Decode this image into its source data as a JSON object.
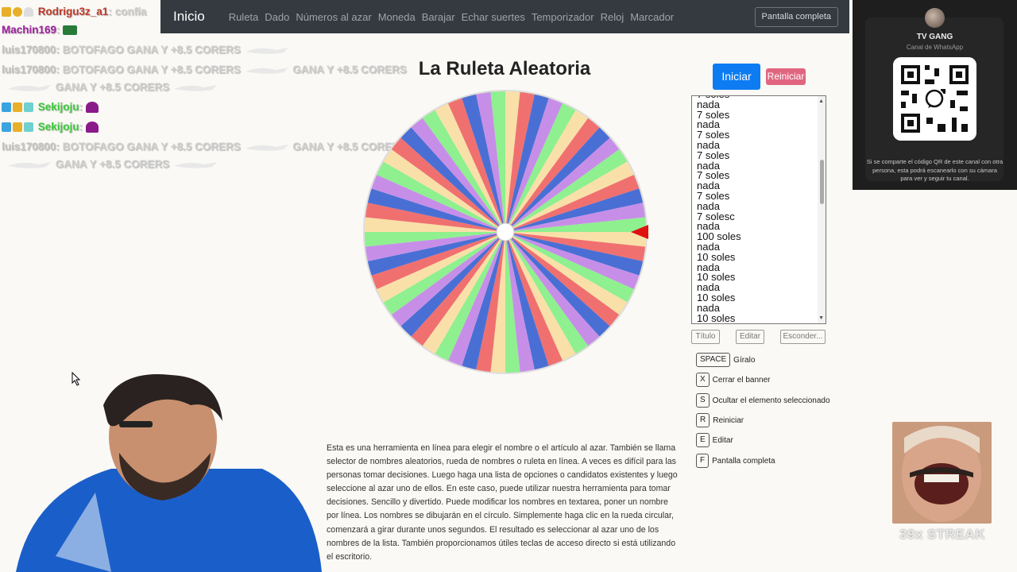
{
  "navbar": {
    "brand": "Inicio",
    "links": [
      "Ruleta",
      "Dado",
      "Números al azar",
      "Moneda",
      "Barajar",
      "Echar suertes",
      "Temporizador",
      "Reloj",
      "Marcador"
    ],
    "fullscreen_label": "Pantalla completa"
  },
  "chat": {
    "lines": [
      {
        "user": "Rodrigu3z_a1",
        "sep": ":",
        "msg": "confía"
      },
      {
        "user": "Machin169",
        "sep": ":",
        "msg": ""
      },
      {
        "user": "luis170800",
        "sep": ":",
        "msg": "BOTOFAGO GANA Y +8.5 CORERS"
      },
      {
        "user": "luis170800",
        "sep": ":",
        "msg": "BOTOFAGO GANA Y +8.5 CORERS"
      },
      {
        "user": "",
        "sep": "",
        "msg": "GANA Y +8.5 CORERS"
      },
      {
        "user": "Sekijoju",
        "sep": ":",
        "msg": ""
      },
      {
        "user": "Sekijoju",
        "sep": ":",
        "msg": ""
      },
      {
        "user": "luis170800",
        "sep": ":",
        "msg": "BOTOFAGO GANA Y +8.5 CORERS"
      },
      {
        "user": "",
        "sep": "",
        "msg": "GANA Y +8.5 CORERS"
      }
    ],
    "inline_extra": "GANA Y +8.5 CORERS"
  },
  "page": {
    "title": "La Ruleta Aleatoria",
    "start_label": "Iniciar",
    "reset_label": "Reiniciar"
  },
  "wheel": {
    "colors": [
      "#f9e0a8",
      "#f07070",
      "#4a6fd4",
      "#c78ee8",
      "#8ef08e"
    ],
    "pointer_color": "#e01010"
  },
  "options": {
    "lines": [
      "7 soles",
      "nada",
      "7 soles",
      "nada",
      "7 soles",
      "nada",
      "7 soles",
      "nada",
      "7 soles",
      "nada",
      "7 soles",
      "nada",
      "7 solesc",
      "nada",
      "100 soles",
      "nada",
      "10 soles",
      "nada",
      "10 soles",
      "nada",
      "10 soles",
      "nada",
      "10 soles"
    ]
  },
  "tools": {
    "title_label": "Título",
    "edit_label": "Editar",
    "hide_label": "Esconder..."
  },
  "shortcuts": [
    {
      "key": "SPACE",
      "label": "Gíralo"
    },
    {
      "key": "X",
      "label": "Cerrar el banner"
    },
    {
      "key": "S",
      "label": "Ocultar el elemento seleccionado"
    },
    {
      "key": "R",
      "label": "Reiniciar"
    },
    {
      "key": "E",
      "label": "Editar"
    },
    {
      "key": "F",
      "label": "Pantalla completa"
    }
  ],
  "description": "Esta es una herramienta en línea para elegir el nombre o el artículo al azar. También se llama selector de nombres aleatorios, rueda de nombres o ruleta en línea. A veces es difícil para las personas tomar decisiones. Luego haga una lista de opciones o candidatos existentes y luego seleccione al azar uno de ellos. En este caso, puede utilizar nuestra herramienta para tomar decisiones. Sencillo y divertido. Puede modificar los nombres en textarea, poner un nombre por línea. Los nombres se dibujarán en el círculo. Simplemente haga clic en la rueda circular, comenzará a girar durante unos segundos. El resultado es seleccionar al azar uno de los nombres de la lista. También proporcionamos útiles teclas de acceso directo si está utilizando el escritorio.",
  "whatsapp": {
    "title": "TV GANG",
    "subtitle": "Canal de WhatsApp",
    "note": "Si se comparte el código QR de este canal con otra persona, esta podrá escanearlo con su cámara para ver y seguir tu canal."
  },
  "overlay": {
    "streak": "39x STREAK"
  }
}
